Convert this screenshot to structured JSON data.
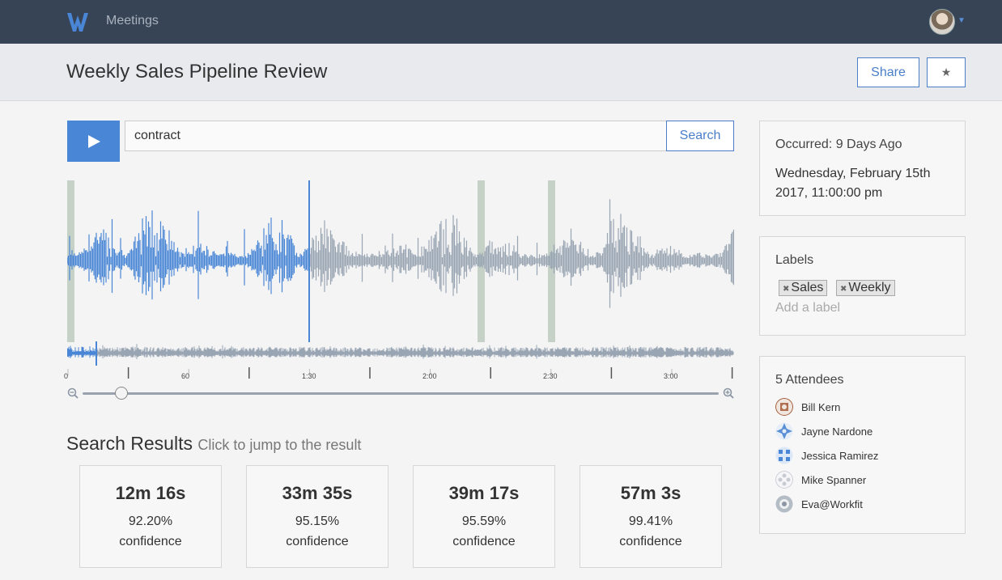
{
  "nav": {
    "title": "Meetings"
  },
  "meeting": {
    "title": "Weekly Sales Pipeline Review",
    "share_label": "Share",
    "star_label": "★"
  },
  "search": {
    "query": "contract",
    "button_label": "Search"
  },
  "timeline": {
    "ticks": [
      "0",
      "60",
      "1:30",
      "2:00",
      "2:30",
      "3:00"
    ]
  },
  "results": {
    "title": "Search Results",
    "subtitle": "Click to jump to the result",
    "items": [
      {
        "time": "12m 16s",
        "confidence": "92.20%",
        "label": "confidence"
      },
      {
        "time": "33m 35s",
        "confidence": "95.15%",
        "label": "confidence"
      },
      {
        "time": "39m 17s",
        "confidence": "95.59%",
        "label": "confidence"
      },
      {
        "time": "57m 3s",
        "confidence": "99.41%",
        "label": "confidence"
      }
    ]
  },
  "details": {
    "occurred": "Occurred: 9 Days Ago",
    "datetime": "Wednesday, February 15th 2017, 11:00:00 pm"
  },
  "labels": {
    "title": "Labels",
    "items": [
      {
        "name": "Sales"
      },
      {
        "name": "Weekly"
      }
    ],
    "add_placeholder": "Add a label"
  },
  "attendees": {
    "title": "5 Attendees",
    "items": [
      {
        "name": "Bill Kern",
        "color": "#a0522d"
      },
      {
        "name": "Jayne Nardone",
        "color": "#5a8fd6"
      },
      {
        "name": "Jessica Ramirez",
        "color": "#4a86d6"
      },
      {
        "name": "Mike Spanner",
        "color": "#c8ccd2"
      },
      {
        "name": "Eva@Workfit",
        "color": "#8c96a4"
      }
    ]
  },
  "colors": {
    "topbar": "#364456",
    "accent": "#4a86d6",
    "waveform": "#99a5b3",
    "highlight": "#c5d1c7"
  },
  "icons": {
    "logo": "workfit-logo-icon",
    "play": "play-icon",
    "zoom_out": "zoom-out-icon",
    "zoom_in": "zoom-in-icon"
  },
  "playback": {
    "position_fraction": 0.36,
    "zoom_level_fraction": 0.06
  }
}
